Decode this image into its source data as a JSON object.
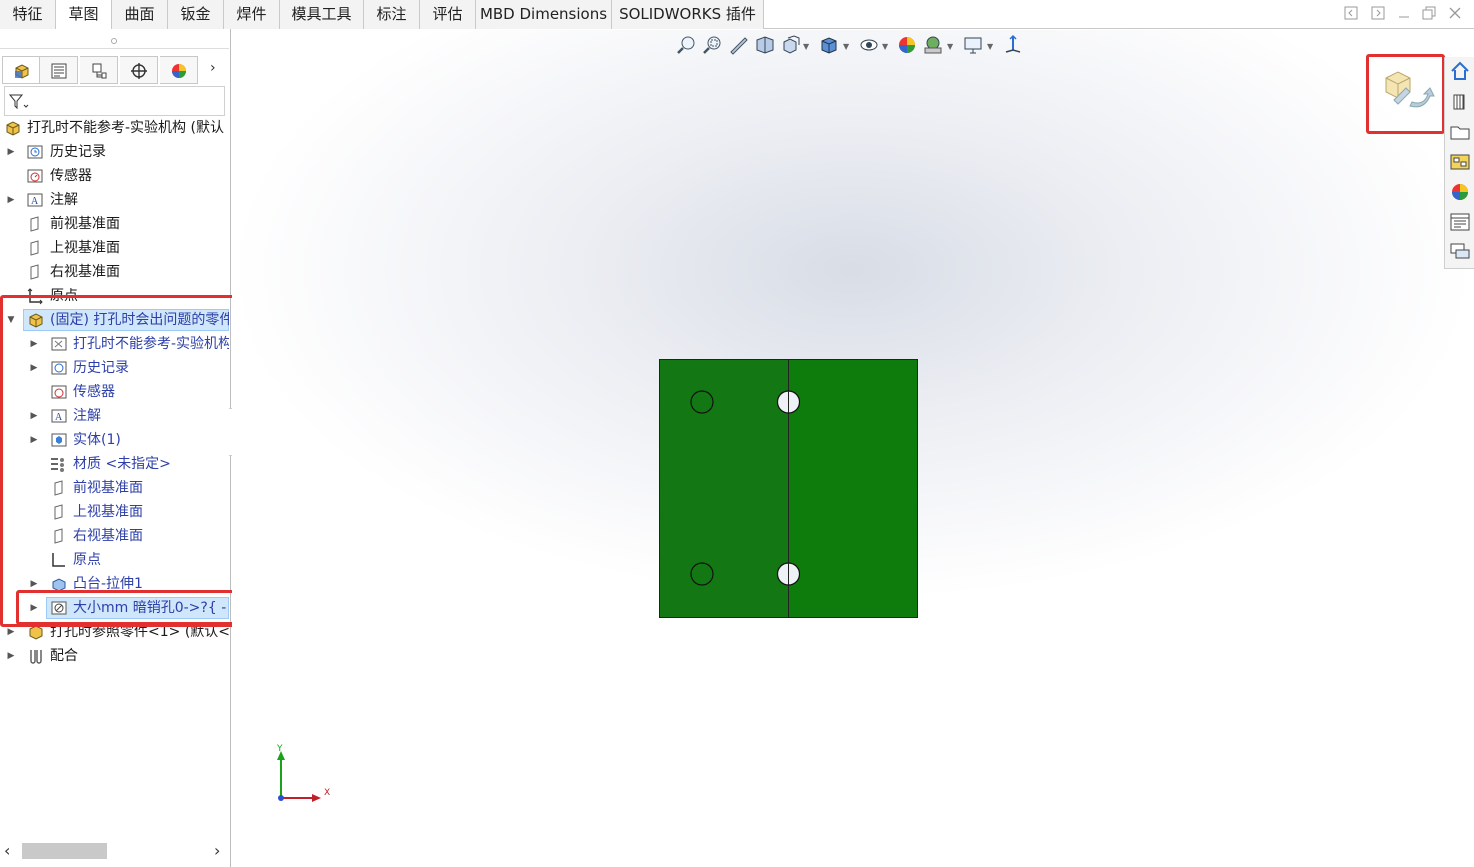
{
  "tabs": [
    {
      "label": "特征",
      "active": false
    },
    {
      "label": "草图",
      "active": true
    },
    {
      "label": "曲面",
      "active": false
    },
    {
      "label": "钣金",
      "active": false
    },
    {
      "label": "焊件",
      "active": false
    },
    {
      "label": "模具工具",
      "active": false
    },
    {
      "label": "标注",
      "active": false
    },
    {
      "label": "评估",
      "active": false
    },
    {
      "label": "MBD Dimensions",
      "active": false
    },
    {
      "label": "SOLIDWORKS 插件",
      "active": false
    }
  ],
  "window_controls": [
    "restore-left-icon",
    "restore-right-icon",
    "minimize-icon",
    "maximize-icon",
    "close-icon"
  ],
  "feature_tree": {
    "root": "打孔时不能参考-实验机构  (默认",
    "top_items": [
      {
        "label": "历史记录",
        "icon": "history-icon"
      },
      {
        "label": "传感器",
        "icon": "sensor-icon"
      },
      {
        "label": "注解",
        "icon": "annotation-icon"
      },
      {
        "label": "前视基准面",
        "icon": "plane-icon"
      },
      {
        "label": "上视基准面",
        "icon": "plane-icon"
      },
      {
        "label": "右视基准面",
        "icon": "plane-icon"
      },
      {
        "label": "原点",
        "icon": "origin-icon"
      }
    ],
    "component": {
      "label": "(固定) 打孔时会出问题的零件",
      "children": [
        {
          "label": "打孔时不能参考-实验机构",
          "icon": "history-icon"
        },
        {
          "label": "历史记录",
          "icon": "history-icon"
        },
        {
          "label": "传感器",
          "icon": "sensor-icon"
        },
        {
          "label": "注解",
          "icon": "annotation-icon"
        },
        {
          "label": "实体(1)",
          "icon": "solid-body-icon"
        },
        {
          "label": "材质 <未指定>",
          "icon": "material-icon"
        },
        {
          "label": "前视基准面",
          "icon": "plane-icon"
        },
        {
          "label": "上视基准面",
          "icon": "plane-icon"
        },
        {
          "label": "右视基准面",
          "icon": "plane-icon"
        },
        {
          "label": "原点",
          "icon": "origin-icon"
        },
        {
          "label": "凸台-拉伸1",
          "icon": "extrude-icon"
        },
        {
          "label": "大小mm 暗销孔0->?{ -",
          "icon": "hole-wizard-icon"
        }
      ]
    },
    "bottom_items": [
      {
        "label": "打孔时参照零件<1> (默认<",
        "icon": "part-icon"
      },
      {
        "label": "配合",
        "icon": "mates-icon"
      }
    ]
  },
  "viewport": {
    "triad_x": "X",
    "triad_y": "Y",
    "part_color": "#127a12",
    "accent_red": "#e23030"
  }
}
